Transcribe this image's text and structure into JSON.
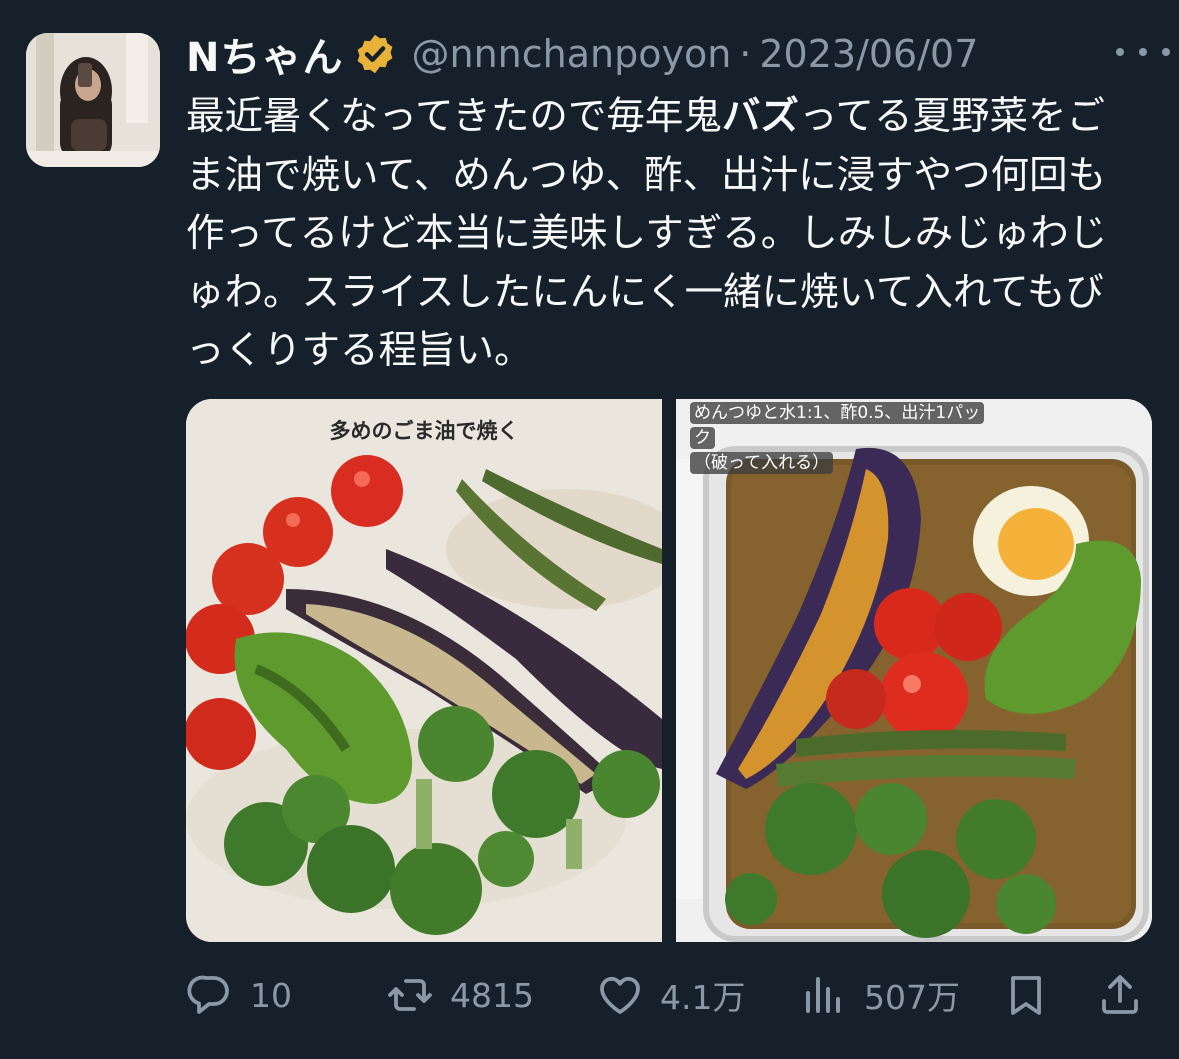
{
  "tweet": {
    "display_name": "Nちゃん",
    "handle": "@nnnchanpoyon",
    "separator": "·",
    "date": "2023/06/07",
    "text_before_bold": "最近暑くなってきたので毎年鬼",
    "text_bold": "バズ",
    "text_after_bold": "ってる夏野菜をごま油で焼いて、めんつゆ、酢、出汁に浸すやつ何回も作ってるけど本当に美味しすぎる。しみしみじゅわじゅわ。スライスしたにんにく一緒に焼いて入れてもびっくりする程旨い。"
  },
  "media": {
    "left_caption": "多めのごま油で焼く",
    "right_caption_line1": "めんつゆと水1:1、酢0.5、出汁1パック",
    "right_caption_line2": "（破って入れる）"
  },
  "actions": {
    "replies": "10",
    "retweets": "4815",
    "likes": "4.1万",
    "views": "507万"
  },
  "colors": {
    "background": "#15202b",
    "text_primary": "#f7f9f9",
    "text_secondary": "#8b98a5",
    "verified_badge": "#e8b23a"
  },
  "icons": {
    "verified": "verified-badge-icon",
    "more": "more-dots-icon",
    "reply": "reply-icon",
    "retweet": "retweet-icon",
    "like": "heart-icon",
    "views": "views-bar-chart-icon",
    "bookmark": "bookmark-icon",
    "share": "share-icon"
  }
}
